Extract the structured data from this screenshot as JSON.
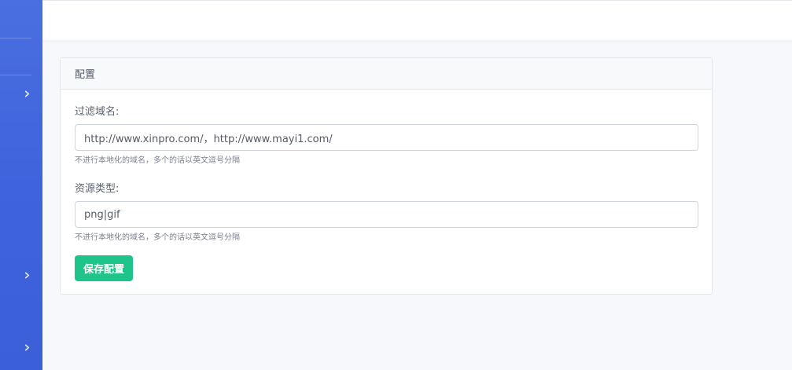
{
  "colors": {
    "sidebar": "#4167dd",
    "accent": "#1fc48a",
    "background": "#f7f8fc"
  },
  "sidebar": {
    "items": [
      {
        "icon": "chevron-right-icon"
      },
      {
        "icon": "chevron-right-icon"
      },
      {
        "icon": "chevron-right-icon"
      }
    ]
  },
  "card": {
    "title": "配置",
    "fields": [
      {
        "label": "过滤域名:",
        "value": "http://www.xinpro.com/，http://www.mayi1.com/",
        "help": "不进行本地化的域名，多个的话以英文逗号分隔"
      },
      {
        "label": "资源类型:",
        "value": "png|gif",
        "help": "不进行本地化的域名，多个的话以英文逗号分隔"
      }
    ],
    "save_label": "保存配置"
  }
}
